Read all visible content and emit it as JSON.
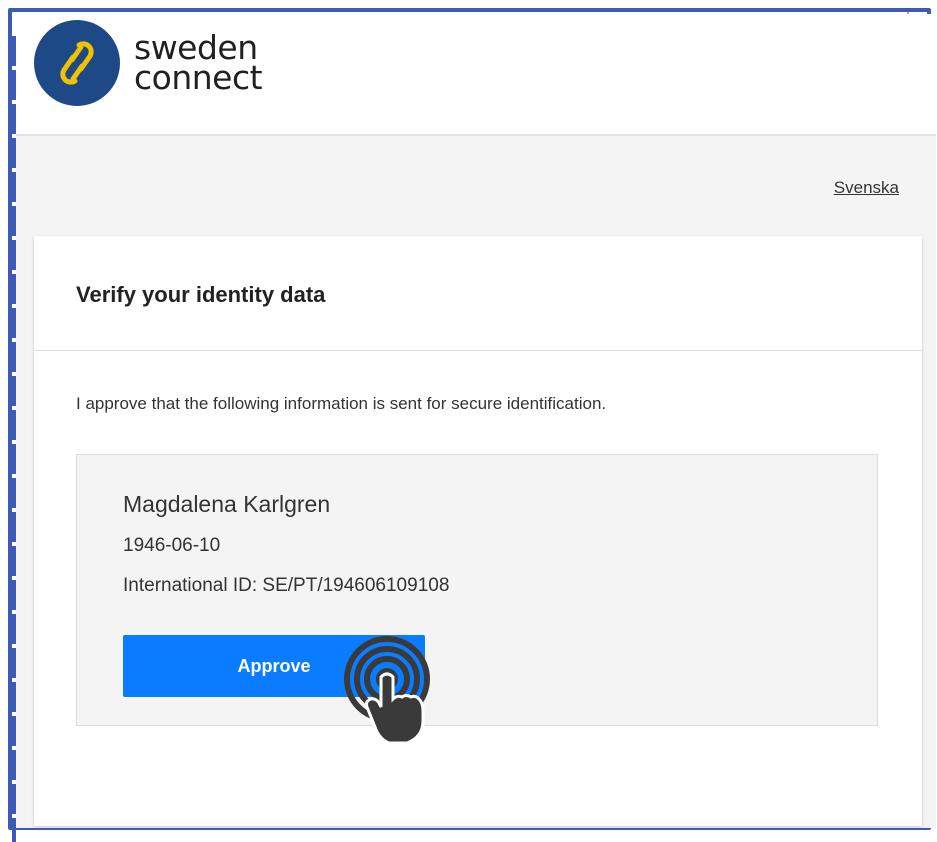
{
  "brand": {
    "line1": "sweden",
    "line2": "connect",
    "accent": "#1d4a86",
    "mark_color": "#f2c200"
  },
  "header": {
    "language_link": "Svenska"
  },
  "card": {
    "title": "Verify your identity data",
    "intro": "I approve that the following information is sent for secure identification."
  },
  "identity": {
    "name": "Magdalena Karlgren",
    "birth_date": "1946-06-10",
    "international_id": "International ID: SE/PT/194606109108"
  },
  "actions": {
    "approve_label": "Approve",
    "approve_color": "#0a7cff"
  },
  "icons": {
    "logo": "chain-link-icon",
    "tap": "tap-gesture-icon"
  }
}
